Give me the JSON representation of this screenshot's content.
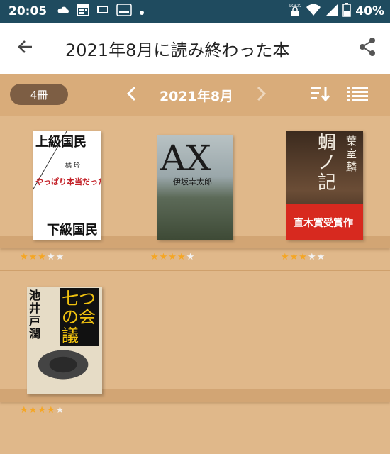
{
  "status_bar": {
    "time": "20:05",
    "battery": "40%",
    "lock_label": "LOCK",
    "icons": [
      "cloud-icon",
      "calendar-icon",
      "tv-icon",
      "au-pay-icon",
      "dot-icon",
      "lock-icon",
      "wifi-icon",
      "signal-icon",
      "battery-icon"
    ]
  },
  "app_bar": {
    "title": "2021年8月に読み終わった本",
    "back_icon": "arrow-left-icon",
    "share_icon": "share-icon"
  },
  "toolbar": {
    "count": "4冊",
    "month": "2021年8月",
    "prev_icon": "chevron-left-icon",
    "next_icon": "chevron-right-icon",
    "sort_icon": "sort-icon",
    "view_icon": "list-view-icon"
  },
  "books": [
    {
      "cover_title_top": "上級国民",
      "cover_title_bottom": "下級国民",
      "cover_author": "橘 玲",
      "cover_subtitle": "やっぱり本当だった。",
      "rating": 3,
      "max_rating": 5
    },
    {
      "cover_title": "AX",
      "cover_author": "伊坂幸太郎",
      "rating": 4,
      "max_rating": 5
    },
    {
      "cover_title": "蜩ノ記",
      "cover_author": "葉室 麟",
      "cover_award": "直木賞受賞作",
      "rating": 3,
      "max_rating": 5
    },
    {
      "cover_title": "七つの会議",
      "cover_author": "池井戸 潤",
      "rating": 4,
      "max_rating": 5
    }
  ],
  "colors": {
    "status_bar": "#1f4b5f",
    "shelf": "#e0b88a",
    "toolbar": "#d9ac7a",
    "pill": "#7d5e44",
    "star_on": "#f5a623",
    "star_off": "#f2f2f2"
  }
}
